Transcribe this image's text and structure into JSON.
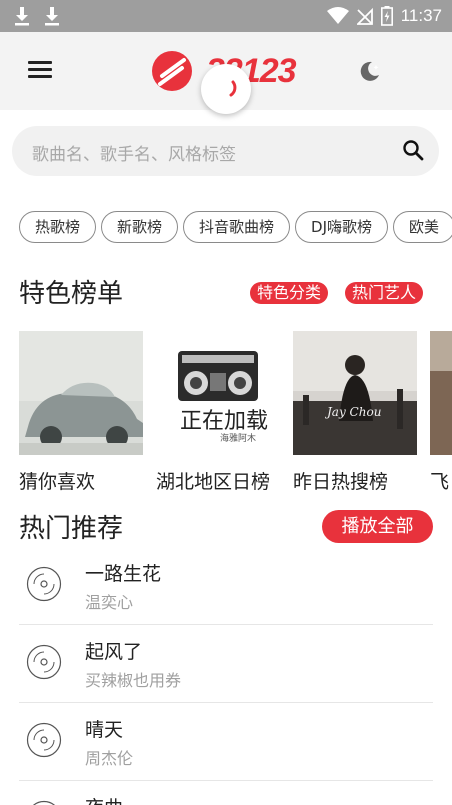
{
  "status_bar": {
    "time": "11:37"
  },
  "app_bar": {
    "logo_text": "22123",
    "menu_icon": "menu-icon",
    "night_icon": "night-mode-icon"
  },
  "search": {
    "placeholder": "歌曲名、歌手名、风格标签",
    "icon": "search-icon"
  },
  "chips": [
    "热歌榜",
    "新歌榜",
    "抖音歌曲榜",
    "DJ嗨歌榜",
    "欧美"
  ],
  "featured": {
    "title": "特色榜单",
    "tag_category": "特色分类",
    "tag_artists": "热门艺人",
    "cards": [
      {
        "title": "猜你喜欢"
      },
      {
        "title": "湖北地区日榜",
        "cover_text": "正在加载",
        "cover_sub": "海雅阿木"
      },
      {
        "title": "昨日热搜榜",
        "cover_text": "Jay Chou"
      },
      {
        "title": "飞"
      }
    ]
  },
  "hot": {
    "title": "热门推荐",
    "play_all": "播放全部",
    "songs": [
      {
        "name": "一路生花",
        "artist": "温奕心"
      },
      {
        "name": "起风了",
        "artist": "买辣椒也用券"
      },
      {
        "name": "晴天",
        "artist": "周杰伦"
      },
      {
        "name": "夜曲",
        "artist": ""
      }
    ]
  },
  "colors": {
    "accent": "#e8323c",
    "status_bar": "#9e9e9e",
    "app_bar": "#f3f3f3"
  }
}
